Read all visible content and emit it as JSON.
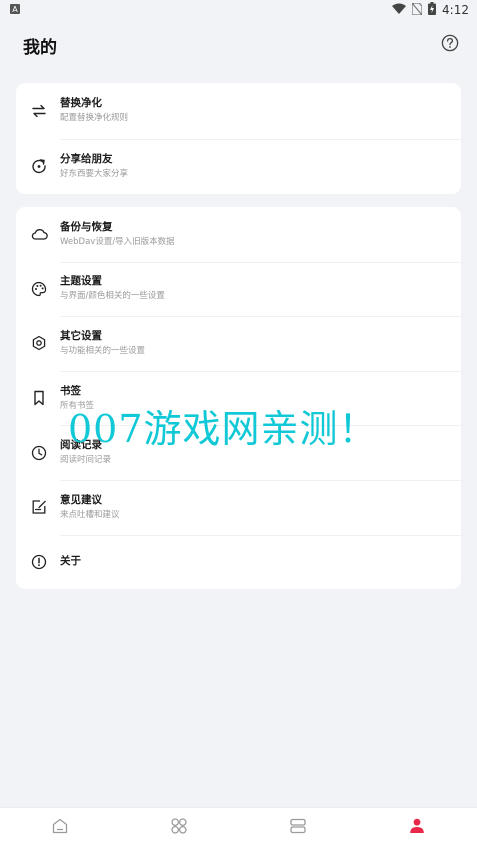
{
  "status_bar": {
    "time": "4:12",
    "icons": [
      "a-notification-icon",
      "wifi-icon",
      "no-sim-icon",
      "battery-charging-icon"
    ]
  },
  "header": {
    "title": "我的",
    "help_icon": "help-circle-icon"
  },
  "section1": [
    {
      "id": "replace-purify",
      "icon": "swap-arrows-icon",
      "title": "替换净化",
      "subtitle": "配置替换净化规则"
    },
    {
      "id": "share",
      "icon": "share-refresh-icon",
      "title": "分享给朋友",
      "subtitle": "好东西要大家分享"
    }
  ],
  "section2": [
    {
      "id": "backup-restore",
      "icon": "cloud-icon",
      "title": "备份与恢复",
      "subtitle": "WebDav设置/导入旧版本数据"
    },
    {
      "id": "theme-settings",
      "icon": "palette-icon",
      "title": "主题设置",
      "subtitle": "与界面/颜色相关的一些设置"
    },
    {
      "id": "other-settings",
      "icon": "gear-icon",
      "title": "其它设置",
      "subtitle": "与功能相关的一些设置"
    },
    {
      "id": "bookmarks",
      "icon": "bookmark-icon",
      "title": "书签",
      "subtitle": "所有书签"
    },
    {
      "id": "reading-records",
      "icon": "clock-icon",
      "title": "阅读记录",
      "subtitle": "阅读时间记录"
    },
    {
      "id": "feedback",
      "icon": "edit-note-icon",
      "title": "意见建议",
      "subtitle": "来点吐槽和建议"
    },
    {
      "id": "about",
      "icon": "info-alert-icon",
      "title": "关于",
      "subtitle": ""
    }
  ],
  "watermark": "007游戏网亲测！",
  "bottom_nav": [
    {
      "id": "bookshelf",
      "icon": "home-icon",
      "active": false
    },
    {
      "id": "discover",
      "icon": "grid-flower-icon",
      "active": false
    },
    {
      "id": "rss",
      "icon": "layers-icon",
      "active": false
    },
    {
      "id": "my",
      "icon": "person-icon",
      "active": true
    }
  ],
  "colors": {
    "accent": "#e8274b",
    "watermark": "#11c9d6",
    "background": "#f2f3f7"
  }
}
